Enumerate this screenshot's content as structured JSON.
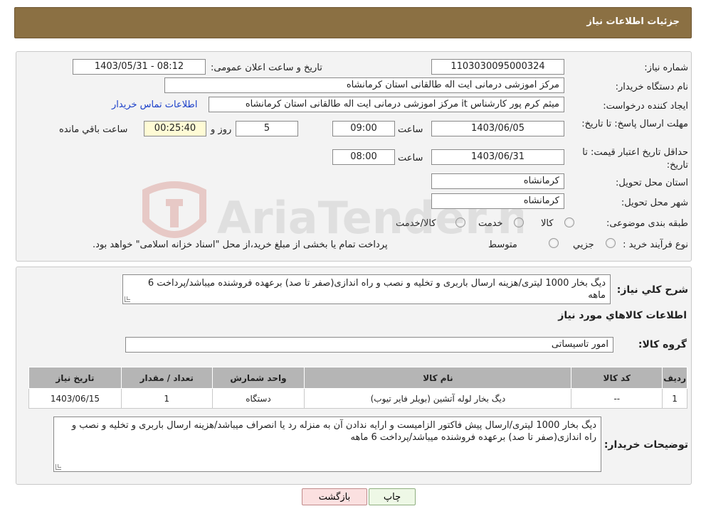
{
  "header": {
    "title": "جزئیات اطلاعات نیاز"
  },
  "form": {
    "need_number_label": "شماره نیاز:",
    "need_number": "1103030095000324",
    "announce_label": "تاریخ و ساعت اعلان عمومی:",
    "announce_value": "1403/05/31 - 08:12",
    "buyer_org_label": "نام دستگاه خریدار:",
    "buyer_org": "مرکز اموزشی درمانی ایت اله طالقانی استان کرمانشاه",
    "creator_label": "ایجاد کننده درخواست:",
    "creator": "میثم کرم پور کارشناس it مرکز اموزشی درمانی ایت اله طالقانی استان کرمانشاه",
    "contact_link": "اطلاعات تماس خریدار",
    "reply_deadline_label": "مهلت ارسال پاسخ: تا تاریخ:",
    "reply_date": "1403/06/05",
    "time_label": "ساعت",
    "reply_time": "09:00",
    "days_value": "5",
    "days_label": "روز و",
    "remaining_time": "00:25:40",
    "remaining_label": "ساعت باقي مانده",
    "price_validity_label": "حداقل تاریخ اعتبار قیمت: تا تاریخ:",
    "price_date": "1403/06/31",
    "price_time": "08:00",
    "province_label": "استان محل تحویل:",
    "province": "کرمانشاه",
    "city_label": "شهر محل تحویل:",
    "city": "کرمانشاه",
    "category_label": "طبقه بندی موضوعی:",
    "category_options": [
      "کالا",
      "خدمت",
      "کالا/خدمت"
    ],
    "process_label": "نوع فرآیند خرید :",
    "process_options": [
      "جزیي",
      "متوسط"
    ],
    "process_note": "پرداخت تمام یا بخشی از مبلغ خرید،از محل \"اسناد خزانه اسلامی\" خواهد بود."
  },
  "details": {
    "summary_label": "شرح کلي نياز:",
    "summary": "دیگ بخار 1000 لیتری/هزینه ارسال باربری و تخلیه و نصب و راه اندازی(صفر تا صد) برعهده فروشنده میباشد/پرداخت 6 ماهه",
    "goods_info_title": "اطلاعات کالاهاي مورد نياز",
    "goods_group_label": "گروه کالا:",
    "goods_group": "امور تاسیساتی",
    "table": {
      "headers": [
        "رديف",
        "کد کالا",
        "نام کالا",
        "واحد شمارش",
        "تعداد / مقدار",
        "تاریخ نیاز"
      ],
      "rows": [
        [
          "1",
          "--",
          "دیگ بخار لوله آتشین (بویلر فایر تیوب)",
          "دستگاه",
          "1",
          "1403/06/15"
        ]
      ]
    },
    "buyer_notes_label": "توضیحات خریدار:",
    "buyer_notes": "دیگ بخار 1000 لیتری/ارسال پیش فاکتور الزامیست و ارایه ندادن آن به منزله رد یا انصراف میباشد/هزینه ارسال باربری و تخلیه و نصب و راه اندازی(صفر تا صد) برعهده فروشنده میباشد/پرداخت 6 ماهه"
  },
  "buttons": {
    "print": "چاپ",
    "back": "بازگشت"
  },
  "watermark": {
    "text": "AriaTender.neT"
  }
}
